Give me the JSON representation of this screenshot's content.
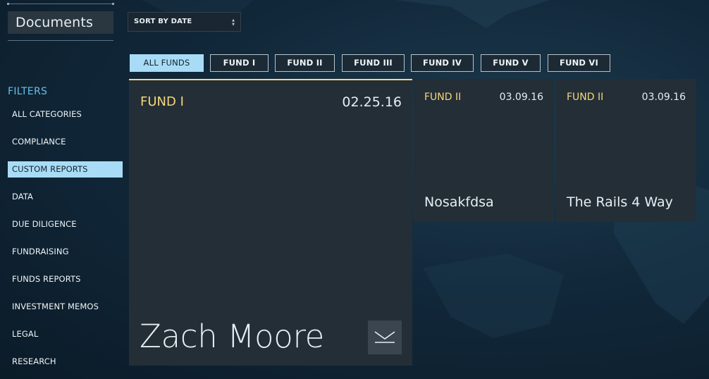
{
  "sidebar": {
    "title": "Documents",
    "filters_label": "FILTERS",
    "items": [
      {
        "label": "ALL CATEGORIES",
        "active": false
      },
      {
        "label": "COMPLIANCE",
        "active": false
      },
      {
        "label": "CUSTOM REPORTS",
        "active": true
      },
      {
        "label": "DATA",
        "active": false
      },
      {
        "label": "DUE DILIGENCE",
        "active": false
      },
      {
        "label": "FUNDRAISING",
        "active": false
      },
      {
        "label": "FUNDS REPORTS",
        "active": false
      },
      {
        "label": "INVESTMENT MEMOS",
        "active": false
      },
      {
        "label": "LEGAL",
        "active": false
      },
      {
        "label": "RESEARCH",
        "active": false
      }
    ]
  },
  "sort": {
    "selected": "SORT BY DATE"
  },
  "tabs": [
    {
      "label": "ALL FUNDS",
      "active": true
    },
    {
      "label": "FUND I",
      "active": false
    },
    {
      "label": "FUND II",
      "active": false
    },
    {
      "label": "FUND III",
      "active": false
    },
    {
      "label": "FUND IV",
      "active": false
    },
    {
      "label": "FUND V",
      "active": false
    },
    {
      "label": "FUND VI",
      "active": false
    }
  ],
  "cards": [
    {
      "fund": "FUND I",
      "date": "02.25.16",
      "name": "Zach Moore"
    },
    {
      "fund": "FUND II",
      "date": "03.09.16",
      "name": "Nosakfdsa"
    },
    {
      "fund": "FUND II",
      "date": "03.09.16",
      "name": "The Rails 4 Way"
    }
  ],
  "colors": {
    "accent_active": "#a8dcf6",
    "fund_label": "#f4d77a",
    "filters_label": "#6bbfe6",
    "card_bg": "#242e36"
  },
  "icons": {
    "download": "chevron-down-icon"
  }
}
